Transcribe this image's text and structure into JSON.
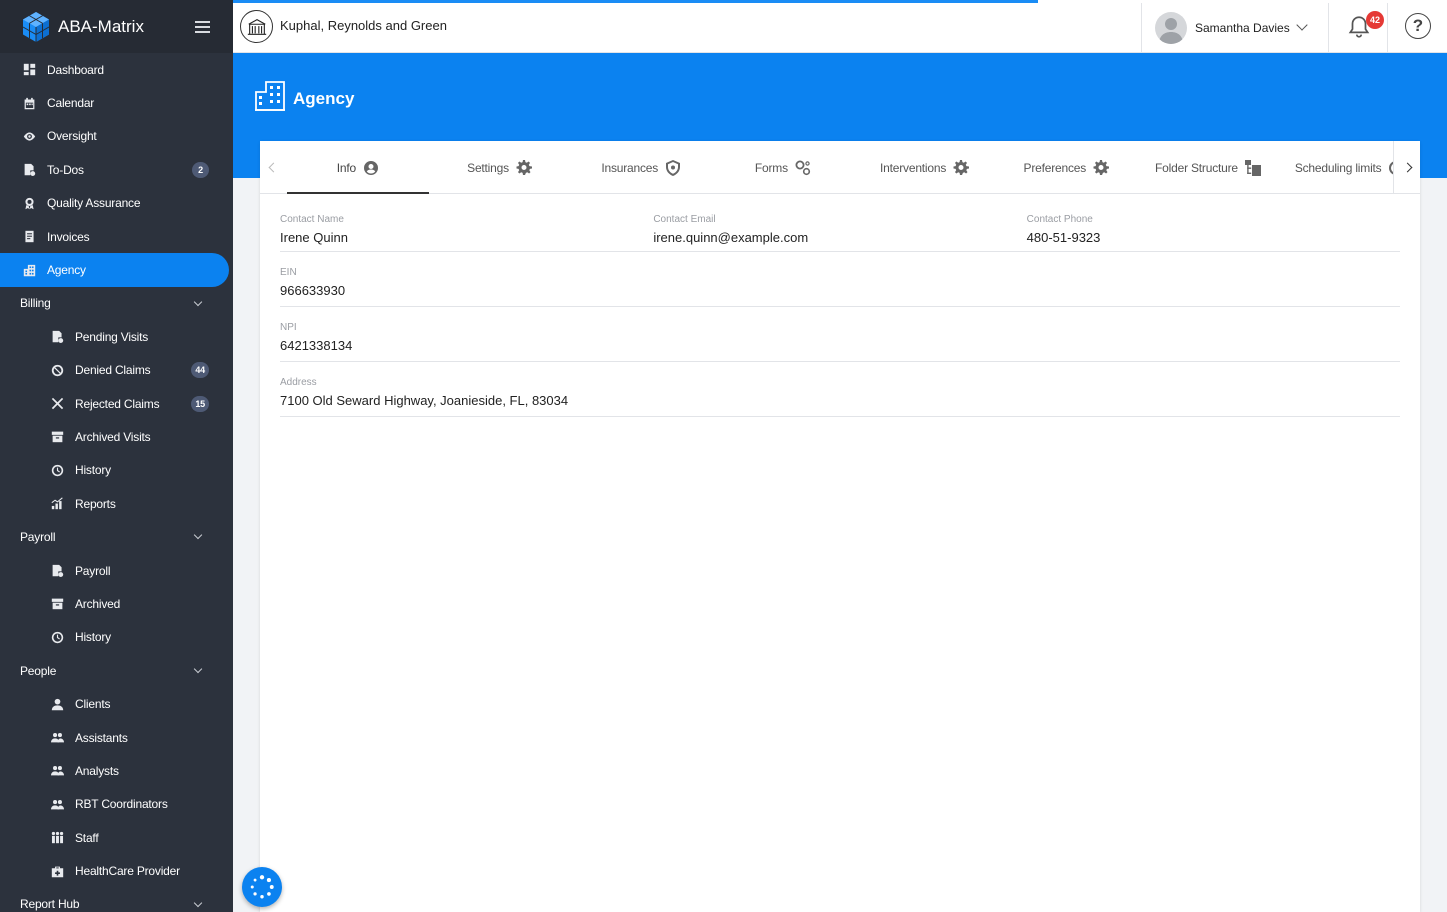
{
  "app": {
    "name": "ABA-Matrix",
    "colors": {
      "sidebar": "#2c323d",
      "accent": "#0b82f0",
      "badge": "#4e5a75",
      "alert": "#e53935"
    }
  },
  "sidebar": {
    "top_items": [
      {
        "label": "Dashboard",
        "icon": "dashboard-icon"
      },
      {
        "label": "Calendar",
        "icon": "calendar-icon"
      },
      {
        "label": "Oversight",
        "icon": "eye-icon"
      },
      {
        "label": "To-Dos",
        "icon": "todo-icon",
        "badge": "2"
      },
      {
        "label": "Quality Assurance",
        "icon": "award-icon"
      },
      {
        "label": "Invoices",
        "icon": "invoice-icon"
      },
      {
        "label": "Agency",
        "icon": "building-icon",
        "active": true
      }
    ],
    "billing": {
      "label": "Billing",
      "items": [
        {
          "label": "Pending Visits",
          "icon": "pending-icon"
        },
        {
          "label": "Denied Claims",
          "icon": "ban-icon",
          "badge": "44"
        },
        {
          "label": "Rejected Claims",
          "icon": "x-icon",
          "badge": "15"
        },
        {
          "label": "Archived Visits",
          "icon": "archive-icon"
        },
        {
          "label": "History",
          "icon": "history-icon"
        },
        {
          "label": "Reports",
          "icon": "chart-icon"
        }
      ]
    },
    "payroll": {
      "label": "Payroll",
      "items": [
        {
          "label": "Payroll",
          "icon": "payroll-icon"
        },
        {
          "label": "Archived",
          "icon": "archive-icon"
        },
        {
          "label": "History",
          "icon": "history-icon"
        }
      ]
    },
    "people": {
      "label": "People",
      "items": [
        {
          "label": "Clients",
          "icon": "user-icon"
        },
        {
          "label": "Assistants",
          "icon": "users-icon"
        },
        {
          "label": "Analysts",
          "icon": "users-icon"
        },
        {
          "label": "RBT Coordinators",
          "icon": "users-icon"
        },
        {
          "label": "Staff",
          "icon": "staff-icon"
        },
        {
          "label": "HealthCare Provider",
          "icon": "medkit-icon"
        }
      ]
    },
    "report_hub": {
      "label": "Report Hub"
    }
  },
  "topbar": {
    "organization": "Kuphal, Reynolds and Green",
    "user_name": "Samantha Davies",
    "notification_count": "42",
    "help_glyph": "?",
    "progress": 0.663
  },
  "page": {
    "title": "Agency",
    "tabs": [
      {
        "label": "Info",
        "icon": "user-circle-icon",
        "active": true
      },
      {
        "label": "Settings",
        "icon": "gear-icon"
      },
      {
        "label": "Insurances",
        "icon": "shield-icon"
      },
      {
        "label": "Forms",
        "icon": "cogs-icon"
      },
      {
        "label": "Interventions",
        "icon": "gear-icon"
      },
      {
        "label": "Preferences",
        "icon": "gear-icon"
      },
      {
        "label": "Folder Structure",
        "icon": "folder-tree-icon"
      },
      {
        "label": "Scheduling limits",
        "icon": "clock-icon"
      }
    ],
    "info": {
      "contact_name_label": "Contact Name",
      "contact_name": "Irene Quinn",
      "contact_email_label": "Contact Email",
      "contact_email": "irene.quinn@example.com",
      "contact_phone_label": "Contact Phone",
      "contact_phone": "480-51-9323",
      "ein_label": "EIN",
      "ein": "966633930",
      "npi_label": "NPI",
      "npi": "6421338134",
      "address_label": "Address",
      "address": "7100 Old Seward Highway, Joanieside, FL, 83034"
    }
  }
}
